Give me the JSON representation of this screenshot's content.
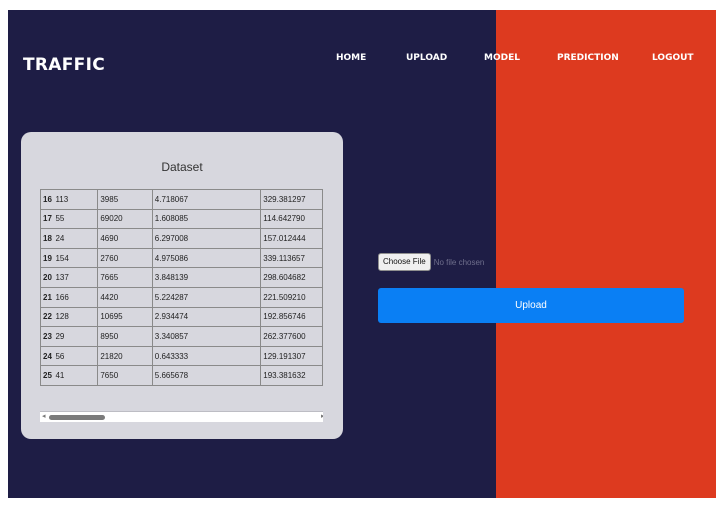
{
  "brand": "TRAFFIC",
  "nav": [
    {
      "label": "HOME"
    },
    {
      "label": "UPLOAD"
    },
    {
      "label": "MODEL"
    },
    {
      "label": "PREDICTION"
    },
    {
      "label": "LOGOUT"
    }
  ],
  "dataset": {
    "title": "Dataset",
    "rows": [
      [
        "16",
        "113",
        "3985",
        "4.718067",
        "329.381297"
      ],
      [
        "17",
        "55",
        "69020",
        "1.608085",
        "114.642790"
      ],
      [
        "18",
        "24",
        "4690",
        "6.297008",
        "157.012444"
      ],
      [
        "19",
        "154",
        "2760",
        "4.975086",
        "339.113657"
      ],
      [
        "20",
        "137",
        "7665",
        "3.848139",
        "298.604682"
      ],
      [
        "21",
        "166",
        "4420",
        "5.224287",
        "221.509210"
      ],
      [
        "22",
        "128",
        "10695",
        "2.934474",
        "192.856746"
      ],
      [
        "23",
        "29",
        "8950",
        "3.340857",
        "262.377600"
      ],
      [
        "24",
        "56",
        "21820",
        "0.643333",
        "129.191307"
      ],
      [
        "25",
        "41",
        "7650",
        "5.665678",
        "193.381632"
      ]
    ]
  },
  "upload": {
    "choose_file_label": "Choose File",
    "file_status": "No file chosen",
    "submit_label": "Upload"
  },
  "colors": {
    "background": "#1e1d45",
    "accent_panel": "#dd3a1f",
    "button": "#0a7ff4"
  }
}
